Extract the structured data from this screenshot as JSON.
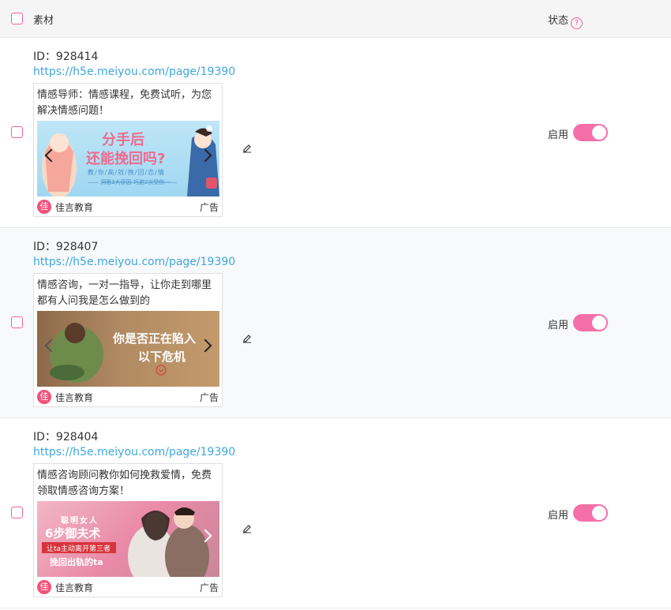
{
  "header": {
    "material_label": "素材",
    "status_label": "状态",
    "help_glyph": "?"
  },
  "rows": [
    {
      "id_text": "ID：928414",
      "url": "https://h5e.meiyou.com/page/19390",
      "desc": "情感导师：情感课程，免费试听，为您解决情感问题！",
      "image": {
        "line1": "分手后",
        "line2": "还能挽回吗?",
        "line3": "教/你/高/效/挽/回/恋/情",
        "line4": "—— 洞悉3大原因  巧避2次受伤 ——"
      },
      "brand_logo": "佳",
      "brand": "佳言教育",
      "ad_tag": "广告",
      "status_text": "启用",
      "enabled": true
    },
    {
      "id_text": "ID：928407",
      "url": "https://h5e.meiyou.com/page/19390",
      "desc": "情感咨询，一对一指导，让你走到哪里都有人问我是怎么做到的",
      "image": {
        "line1": "你是否正在陷入",
        "line2": "以下危机"
      },
      "brand_logo": "佳",
      "brand": "佳言教育",
      "ad_tag": "广告",
      "status_text": "启用",
      "enabled": true
    },
    {
      "id_text": "ID：928404",
      "url": "https://h5e.meiyou.com/page/19390",
      "desc": "情感咨询顾问教你如何挽救爱情，免费领取情感咨询方案！",
      "image": {
        "line1": "聪明女人",
        "line2": "6步御夫术",
        "line3": "让ta主动离开第三者",
        "line4": "挽回出轨的ta"
      },
      "brand_logo": "佳",
      "brand": "佳言教育",
      "ad_tag": "广告",
      "status_text": "启用",
      "enabled": true
    }
  ],
  "colors": {
    "accent": "#f56fa8",
    "link": "#3fa7dc",
    "checkbox_border": "#f0629e"
  }
}
